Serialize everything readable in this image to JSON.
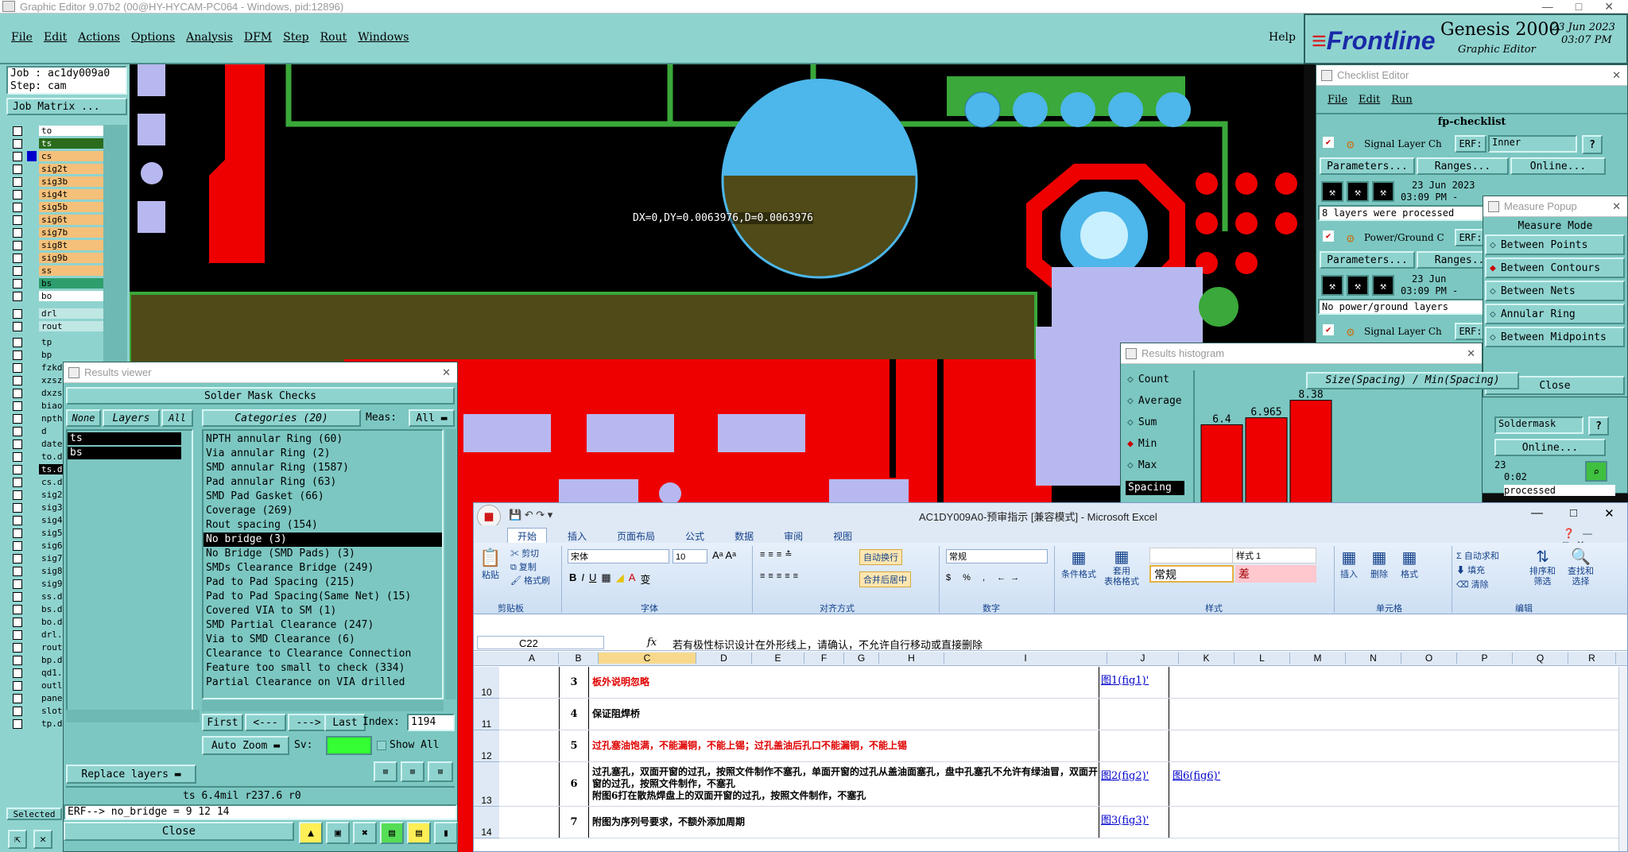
{
  "app": {
    "title": "Graphic Editor 9.07b2 (00@HY-HYCAM-PC064 - Windows, pid:12896)",
    "menu": [
      "File",
      "Edit",
      "Actions",
      "Options",
      "Analysis",
      "DFM",
      "Step",
      "Rout",
      "Windows"
    ],
    "help": "Help",
    "brand": "Frontline",
    "product": "Genesis 2000",
    "subtitle": "Graphic Editor",
    "date": "23 Jun 2023",
    "time": "03:07 PM"
  },
  "job": {
    "job": "Job : ac1dy009a0",
    "step": "Step: cam",
    "matrix_button": "Job Matrix ..."
  },
  "layers": [
    {
      "name": "to",
      "color": "#ffffff"
    },
    {
      "name": "ts",
      "color": "#2a6c1c"
    },
    {
      "name": "cs",
      "color": "#f5c07a"
    },
    {
      "name": "sig2t",
      "color": "#f5c07a"
    },
    {
      "name": "sig3b",
      "color": "#f5c07a"
    },
    {
      "name": "sig4t",
      "color": "#f5c07a"
    },
    {
      "name": "sig5b",
      "color": "#f5c07a"
    },
    {
      "name": "sig6t",
      "color": "#f5c07a"
    },
    {
      "name": "sig7b",
      "color": "#f5c07a"
    },
    {
      "name": "sig8t",
      "color": "#f5c07a"
    },
    {
      "name": "sig9b",
      "color": "#f5c07a"
    },
    {
      "name": "ss",
      "color": "#f5c07a"
    },
    {
      "name": "bs",
      "color": "#2e9e6e"
    },
    {
      "name": "bo",
      "color": "#ffffff"
    }
  ],
  "layers2": [
    "drl",
    "rout"
  ],
  "layers3": [
    "tp",
    "bp",
    "fzkd",
    "xzsz",
    "dxzs",
    "biao",
    "npth",
    "d",
    "date",
    "to.d",
    "ts.d",
    "cs.d",
    "sig2",
    "sig3",
    "sig4",
    "sig5",
    "sig6",
    "sig7",
    "sig8",
    "sig9",
    "ss.d",
    "bs.d",
    "bo.d",
    "drl.",
    "rout",
    "bp.d",
    "qd1.",
    "outl",
    "pane",
    "slot",
    "tp.d"
  ],
  "selected_label": "Selected",
  "measure_overlay": "DX=0,DY=0.0063976,D=0.0063976",
  "results_viewer": {
    "title": "Results viewer",
    "header": "Solder Mask Checks",
    "none": "None",
    "layers_label": "Layers",
    "all": "All",
    "categories_label": "Categories (20)",
    "meas_label": "Meas:",
    "meas_value": "All",
    "layer_items": [
      "ts",
      "bs"
    ],
    "categories": [
      "NPTH annular Ring (60)",
      "Via annular Ring (2)",
      "SMD annular Ring (1587)",
      "Pad annular Ring (63)",
      "SMD Pad Gasket (66)",
      "Coverage (269)",
      "Rout spacing (154)",
      "No bridge (3)",
      "No Bridge (SMD Pads) (3)",
      "SMDs Clearance Bridge (249)",
      "Pad to Pad Spacing (215)",
      "Pad to Pad Spacing(Same Net) (15)",
      "Covered VIA to SM (1)",
      "SMD Partial Clearance (247)",
      "Via to SMD Clearance (6)",
      "Clearance to Clearance Connection",
      "Feature too small to check (334)",
      "Partial Clearance on VIA drilled"
    ],
    "selected_index": 7,
    "first": "First",
    "prev": "<---",
    "next": "--->",
    "last": "Last",
    "index_label": "Index:",
    "index_value": "1194",
    "auto_zoom": "Auto Zoom",
    "sv_label": "Sv:",
    "show_all": "Show All",
    "replace_layers": "Replace layers",
    "status": "ts 6.4mil r237.6 r0",
    "erf_line": "ERF--> no_bridge = 9 12 14",
    "close": "Close"
  },
  "checklist": {
    "title": "Checklist Editor",
    "menu": [
      "File",
      "Edit",
      "Run"
    ],
    "name": "fp-checklist",
    "items": [
      {
        "label": "Signal Layer Ch",
        "erf": "ERF:",
        "erf_value": "Inner",
        "date": "23 Jun 2023",
        "time": "03:09 PM -",
        "msg": "8 layers were processed"
      },
      {
        "label": "Power/Ground C",
        "erf": "ERF:",
        "erf_value": "",
        "date": "23 Jun",
        "time": "03:09 PM -",
        "msg": "No power/ground layers"
      },
      {
        "label": "Signal Layer Ch",
        "erf": "ERF:",
        "erf_value": "",
        "date": "",
        "time": "",
        "msg": ""
      }
    ],
    "params": "Parameters...",
    "ranges": "Ranges...",
    "online": "Online...",
    "soldermask": "Soldermask",
    "date3": "23",
    "time3": "0:02",
    "processed": "processed"
  },
  "measure_popup": {
    "title": "Measure Popup",
    "header": "Measure Mode",
    "modes": [
      "Between Points",
      "Between Contours",
      "Between Nets",
      "Annular Ring",
      "Between Midpoints"
    ],
    "selected": 1,
    "close": "Close"
  },
  "histogram": {
    "title": "Results histogram",
    "options": [
      "Count",
      "Average",
      "Sum",
      "Min",
      "Max"
    ],
    "selected": 3,
    "spacing_label": "Spacing",
    "chart_title": "Size(Spacing) / Min(Spacing)"
  },
  "chart_data": {
    "type": "bar",
    "title": "Size(Spacing) / Min(Spacing)",
    "values": [
      6.4,
      6.965,
      8.38
    ],
    "labels": [
      "6.4",
      "6.965",
      "8.38"
    ],
    "ylim": [
      0,
      9
    ]
  },
  "excel": {
    "title": "AC1DY009A0-预审指示 [兼容模式] - Microsoft Excel",
    "tabs": [
      "开始",
      "插入",
      "页面布局",
      "公式",
      "数据",
      "审阅",
      "视图"
    ],
    "clipboard": {
      "paste": "粘贴",
      "cut": "剪切",
      "copy": "复制",
      "format_painter": "格式刷",
      "group": "剪贴板"
    },
    "font": {
      "name": "宋体",
      "size": "10",
      "group": "字体"
    },
    "align": {
      "wrap": "自动换行",
      "merge": "合并后居中",
      "group": "对齐方式"
    },
    "number": {
      "format": "常规",
      "group": "数字"
    },
    "styles": {
      "cond": "条件格式",
      "table": "套用\n表格格式",
      "normal": "常规",
      "bad": "差",
      "style1": "样式 1",
      "group": "样式"
    },
    "cells": {
      "insert": "插入",
      "delete": "删除",
      "format": "格式",
      "group": "单元格"
    },
    "editing": {
      "autosum": "自动求和",
      "fill": "填充",
      "clear": "清除",
      "sort": "排序和\n筛选",
      "find": "查找和\n选择",
      "group": "编辑"
    },
    "namebox": "C22",
    "fx": "fx",
    "formula": "若有极性标识设计在外形线上，请确认，不允许自行移动或直接删除",
    "columns": [
      "A",
      "B",
      "C",
      "D",
      "E",
      "F",
      "G",
      "H",
      "I",
      "J",
      "K",
      "L",
      "M",
      "N",
      "O",
      "P",
      "Q",
      "R"
    ],
    "rows": [
      {
        "num": "10",
        "idx": "3",
        "text": "板外说明忽略",
        "red": true,
        "link": "图1(fig1)'",
        "link2": ""
      },
      {
        "num": "11",
        "idx": "4",
        "text": "保证阻焊桥",
        "red": false,
        "link": "",
        "link2": ""
      },
      {
        "num": "12",
        "idx": "5",
        "text": "过孔塞油饱满，不能漏铜，不能上锡；过孔盖油后孔口不能漏铜，不能上锡",
        "red": true,
        "link": "",
        "link2": ""
      },
      {
        "num": "13",
        "idx": "6",
        "text": "过孔塞孔，双面开窗的过孔，按照文件制作不塞孔，单面开窗的过孔从盖油面塞孔，盘中孔塞孔不允许有绿油冒，双面开窗的过孔，按照文件制作，不塞孔\n附图6打在散热焊盘上的双面开窗的过孔，按照文件制作，不塞孔",
        "red": false,
        "link": "图2(fig2)'",
        "link2": "图6(fig6)'"
      },
      {
        "num": "14",
        "idx": "7",
        "text": "附图为序列号要求，不额外添加周期",
        "red": false,
        "link": "图3(fig3)'",
        "link2": ""
      }
    ]
  }
}
